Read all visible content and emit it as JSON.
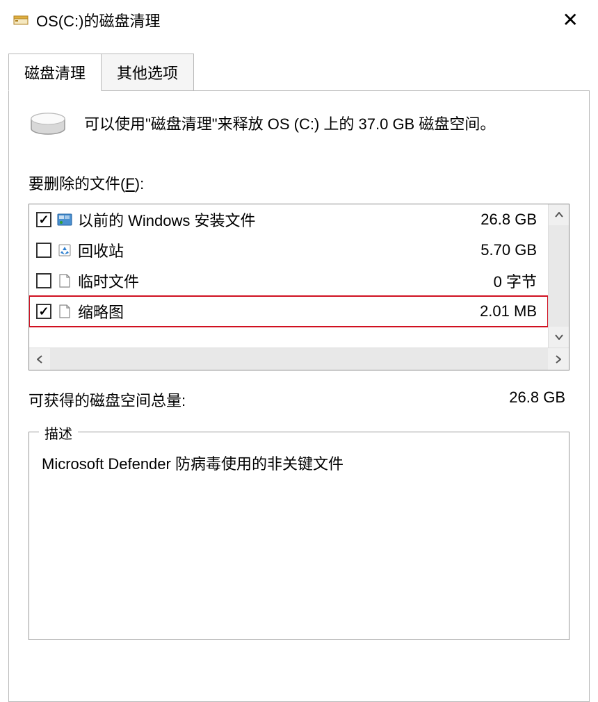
{
  "window": {
    "title": "OS(C:)的磁盘清理"
  },
  "tabs": {
    "cleanup": "磁盘清理",
    "other": "其他选项"
  },
  "summary": "可以使用\"磁盘清理\"来释放 OS (C:) 上的 37.0 GB 磁盘空间。",
  "files_label_prefix": "要删除的文件(",
  "files_label_hotkey": "F",
  "files_label_suffix": "):",
  "files": [
    {
      "checked": true,
      "icon": "windows",
      "label": "以前的 Windows 安装文件",
      "size": "26.8 GB",
      "highlighted": false
    },
    {
      "checked": false,
      "icon": "recycle",
      "label": "回收站",
      "size": "5.70 GB",
      "highlighted": false
    },
    {
      "checked": false,
      "icon": "file",
      "label": "临时文件",
      "size": "0 字节",
      "highlighted": false
    },
    {
      "checked": true,
      "icon": "file",
      "label": "缩略图",
      "size": "2.01 MB",
      "highlighted": true
    }
  ],
  "total": {
    "label": "可获得的磁盘空间总量:",
    "value": "26.8 GB"
  },
  "description": {
    "legend": "描述",
    "text": "Microsoft Defender 防病毒使用的非关键文件"
  }
}
